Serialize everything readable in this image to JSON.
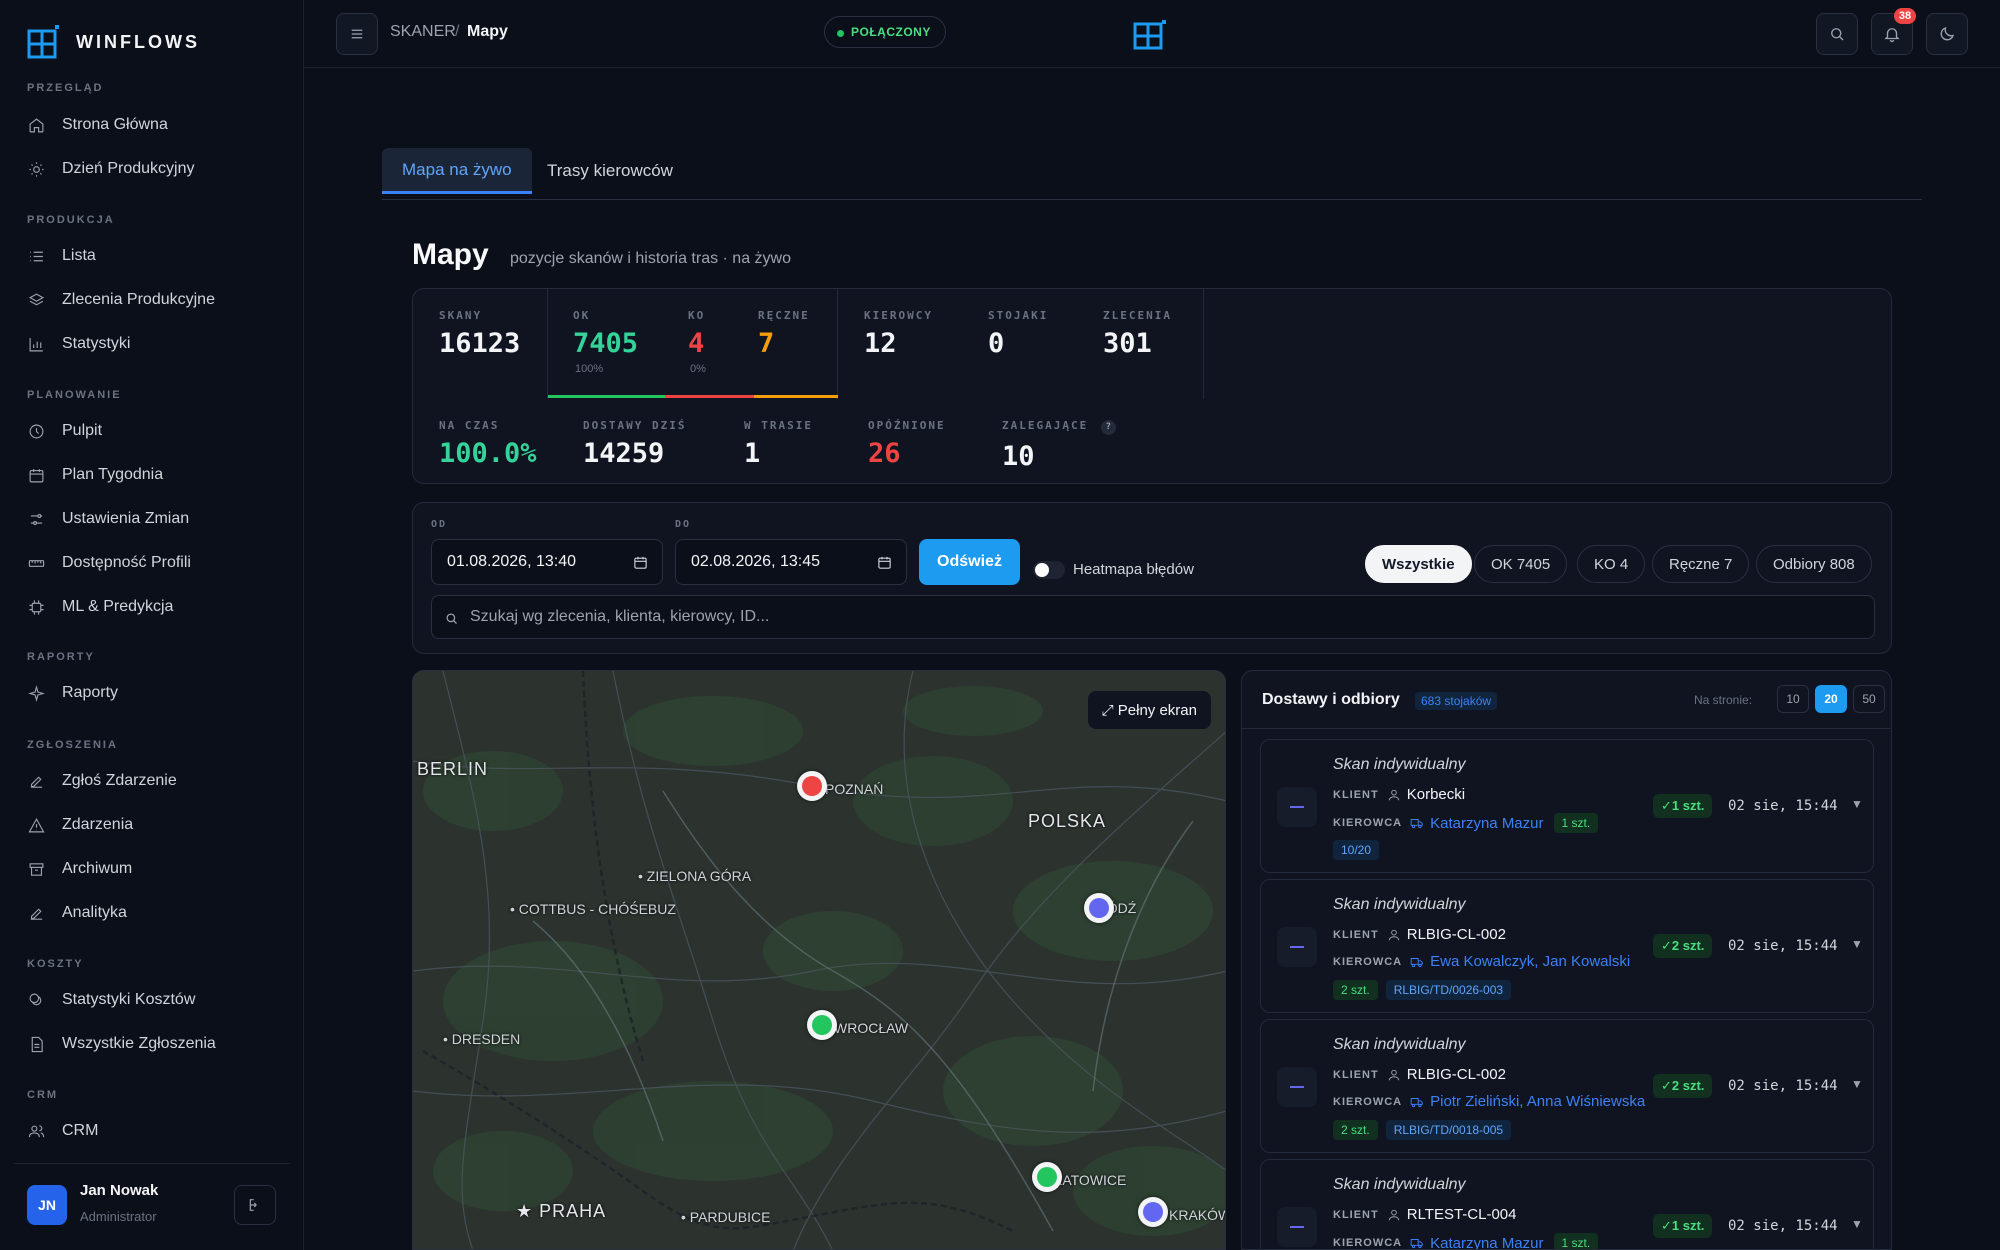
{
  "app": {
    "name": "WINFLOWS"
  },
  "sidebar": {
    "sections": [
      {
        "label": "PRZEGLĄD"
      },
      {
        "label": "PRODUKCJA"
      },
      {
        "label": "PLANOWANIE"
      },
      {
        "label": "RAPORTY"
      },
      {
        "label": "ZGŁOSZENIA"
      },
      {
        "label": "KOSZTY"
      },
      {
        "label": "CRM"
      }
    ],
    "items": [
      {
        "label": "Strona Główna",
        "icon": "home-icon"
      },
      {
        "label": "Dzień Produkcyjny",
        "icon": "sun-icon"
      },
      {
        "label": "Lista",
        "icon": "list-icon"
      },
      {
        "label": "Zlecenia Produkcyjne",
        "icon": "layers-icon"
      },
      {
        "label": "Statystyki",
        "icon": "bar-chart-icon"
      },
      {
        "label": "Pulpit",
        "icon": "clock-icon"
      },
      {
        "label": "Plan Tygodnia",
        "icon": "calendar-icon"
      },
      {
        "label": "Ustawienia Zmian",
        "icon": "sliders-icon"
      },
      {
        "label": "Dostępność Profili",
        "icon": "ruler-icon"
      },
      {
        "label": "ML & Predykcja",
        "icon": "cpu-icon"
      },
      {
        "label": "Raporty",
        "icon": "sparkle-icon"
      },
      {
        "label": "Zgłoś Zdarzenie",
        "icon": "pencil-icon"
      },
      {
        "label": "Zdarzenia",
        "icon": "warning-icon"
      },
      {
        "label": "Archiwum",
        "icon": "archive-icon"
      },
      {
        "label": "Analityka",
        "icon": "pencil-icon"
      },
      {
        "label": "Statystyki Kosztów",
        "icon": "coins-icon"
      },
      {
        "label": "Wszystkie Zgłoszenia",
        "icon": "file-icon"
      },
      {
        "label": "CRM",
        "icon": "users-icon"
      }
    ],
    "user": {
      "initials": "JN",
      "name": "Jan Nowak",
      "role": "Administrator"
    }
  },
  "topbar": {
    "breadcrumb_parent": "SKANER",
    "breadcrumb_separator": "/",
    "breadcrumb_current": "Mapy",
    "status": "POŁĄCZONY",
    "notifications_count": "38"
  },
  "tabs": [
    {
      "label": "Mapa na żywo",
      "active": true
    },
    {
      "label": "Trasy kierowców",
      "active": false
    }
  ],
  "page": {
    "title": "Mapy",
    "subtitle": "pozycje skanów i historia tras · na żywo"
  },
  "stats": {
    "row1": [
      {
        "label": "SKANY",
        "value": "16123",
        "color": "#f3f4f6"
      },
      {
        "label": "OK",
        "value": "7405",
        "sub": "100%",
        "color": "#34d399"
      },
      {
        "label": "KO",
        "value": "4",
        "sub": "0%",
        "color": "#ef4444"
      },
      {
        "label": "RĘCZNE",
        "value": "7",
        "color": "#f59e0b"
      },
      {
        "label": "KIEROWCY",
        "value": "12",
        "color": "#f3f4f6"
      },
      {
        "label": "STOJAKI",
        "value": "0",
        "color": "#f3f4f6"
      },
      {
        "label": "ZLECENIA",
        "value": "301",
        "color": "#f3f4f6"
      }
    ],
    "row2": [
      {
        "label": "NA CZAS",
        "value": "100.0%",
        "color": "#34d399"
      },
      {
        "label": "DOSTAWY DZIŚ",
        "value": "14259",
        "color": "#f3f4f6"
      },
      {
        "label": "W TRASIE",
        "value": "1",
        "color": "#f3f4f6"
      },
      {
        "label": "OPÓŹNIONE",
        "value": "26",
        "color": "#ef4444"
      },
      {
        "label": "ZALEGAJĄCE",
        "value": "10",
        "color": "#f3f4f6",
        "help": "?"
      }
    ]
  },
  "filters": {
    "from_label": "OD",
    "from_value": "01.08.2026, 13:40",
    "to_label": "DO",
    "to_value": "02.08.2026, 13:45",
    "refresh_label": "Odśwież",
    "heatmap_label": "Heatmapa błędów",
    "heatmap_on": false,
    "chips": [
      {
        "label": "Wszystkie",
        "active": true
      },
      {
        "label": "OK 7405",
        "active": false
      },
      {
        "label": "KO 4",
        "active": false
      },
      {
        "label": "Ręczne 7",
        "active": false
      },
      {
        "label": "Odbiory 808",
        "active": false
      }
    ],
    "search_placeholder": "Szukaj wg zlecenia, klienta, kierowcy, ID..."
  },
  "map": {
    "fullscreen_label": "⤢ Pełny ekran",
    "cities": [
      {
        "name": "BERLIN",
        "big": true
      },
      {
        "name": "POZNAŃ"
      },
      {
        "name": "POLSKA",
        "big": true
      },
      {
        "name": "• ZIELONA GÓRA"
      },
      {
        "name": "• COTTBUS - CHÓŚEBUZ"
      },
      {
        "name": "ŁÓDŹ"
      },
      {
        "name": "WROCŁAW"
      },
      {
        "name": "• DRESDEN"
      },
      {
        "name": "KATOWICE"
      },
      {
        "name": "★ PRAHA",
        "big": true
      },
      {
        "name": "• PARDUBICE"
      },
      {
        "name": "KRAKÓW"
      }
    ],
    "markers": [
      {
        "status": "ko",
        "color": "#ef4444"
      },
      {
        "status": "pickup",
        "color": "#6366f1"
      },
      {
        "status": "ok",
        "color": "#22c55e"
      },
      {
        "status": "ok",
        "color": "#22c55e"
      },
      {
        "status": "pickup",
        "color": "#6366f1"
      }
    ]
  },
  "deliveries": {
    "title": "Dostawy i odbiory",
    "count_badge": "683 stojaków",
    "page_size_label": "Na stronie:",
    "page_sizes": [
      "10",
      "20",
      "50"
    ],
    "page_size_active": "20",
    "client_key": "KLIENT",
    "driver_key": "KIEROWCA",
    "items": [
      {
        "type": "Skan indywidualny",
        "client": "Korbecki",
        "driver": "Katarzyna Mazur",
        "inline_tag": "1 szt.",
        "tags": [
          {
            "text": "10/20",
            "kind": "blue"
          }
        ],
        "ok": "✓1 szt.",
        "time": "02 sie, 15:44"
      },
      {
        "type": "Skan indywidualny",
        "client": "RLBIG-CL-002",
        "driver": "Ewa Kowalczyk, Jan Kowalski",
        "inline_tag": "",
        "tags": [
          {
            "text": "2 szt.",
            "kind": "green"
          },
          {
            "text": "RLBIG/TD/0026-003",
            "kind": "blue"
          }
        ],
        "ok": "✓2 szt.",
        "time": "02 sie, 15:44"
      },
      {
        "type": "Skan indywidualny",
        "client": "RLBIG-CL-002",
        "driver": "Piotr Zieliński, Anna Wiśniewska",
        "inline_tag": "",
        "tags": [
          {
            "text": "2 szt.",
            "kind": "green"
          },
          {
            "text": "RLBIG/TD/0018-005",
            "kind": "blue"
          }
        ],
        "ok": "✓2 szt.",
        "time": "02 sie, 15:44"
      },
      {
        "type": "Skan indywidualny",
        "client": "RLTEST-CL-004",
        "driver": "Katarzyna Mazur",
        "inline_tag": "1 szt.",
        "tags": [],
        "ok": "✓1 szt.",
        "time": "02 sie, 15:44"
      }
    ]
  }
}
